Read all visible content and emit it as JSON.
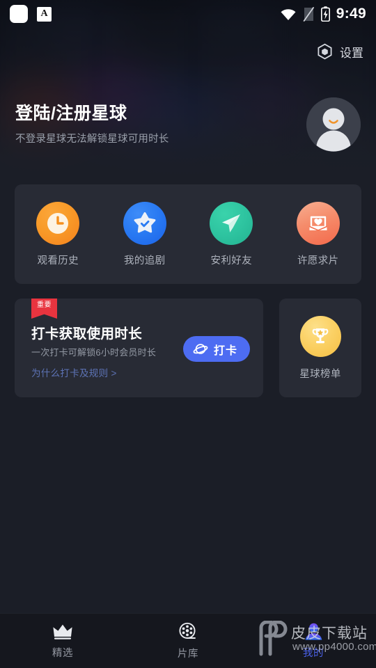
{
  "statusbar": {
    "time": "9:49",
    "app_badge_letter": "A",
    "icons": [
      "app-square-icon",
      "letter-a-icon",
      "wifi-icon",
      "sim-off-icon",
      "battery-charging-icon"
    ]
  },
  "header": {
    "settings_label": "设置",
    "settings_icon": "hexagon-gear-icon",
    "title": "登陆/注册星球",
    "subtitle": "不登录星球无法解锁星球可用时长",
    "avatar_icon": "default-user-avatar"
  },
  "shortcuts": [
    {
      "label": "观看历史",
      "icon": "clock-icon",
      "color": "#f5901e"
    },
    {
      "label": "我的追剧",
      "icon": "star-check-icon",
      "color": "#2a7bf3"
    },
    {
      "label": "安利好友",
      "icon": "paper-plane-icon",
      "color": "#2ec4a0"
    },
    {
      "label": "许愿求片",
      "icon": "envelope-heart-icon",
      "color": "#f4704f"
    }
  ],
  "checkin": {
    "badge": "重要",
    "badge_color": "#e8343f",
    "title": "打卡获取使用时长",
    "subtitle": "一次打卡可解锁6小时会员时长",
    "link": "为什么打卡及规则 >",
    "button_label": "打卡",
    "button_icon": "planet-icon",
    "button_color": "#4d6cf2"
  },
  "rank": {
    "label": "星球榜单",
    "icon": "trophy-icon",
    "color": "#fbd165"
  },
  "bottom_nav": {
    "active_color": "#4a60e8",
    "items": [
      {
        "label": "精选",
        "icon": "crown-icon",
        "active": false
      },
      {
        "label": "片库",
        "icon": "film-reel-icon",
        "active": false
      },
      {
        "label": "我的",
        "icon": "user-icon",
        "active": true
      }
    ]
  },
  "watermark": {
    "site_name": "皮皮下载站",
    "site_url": "www.pp4000.com",
    "logo_icon": "pp-logo-icon"
  }
}
